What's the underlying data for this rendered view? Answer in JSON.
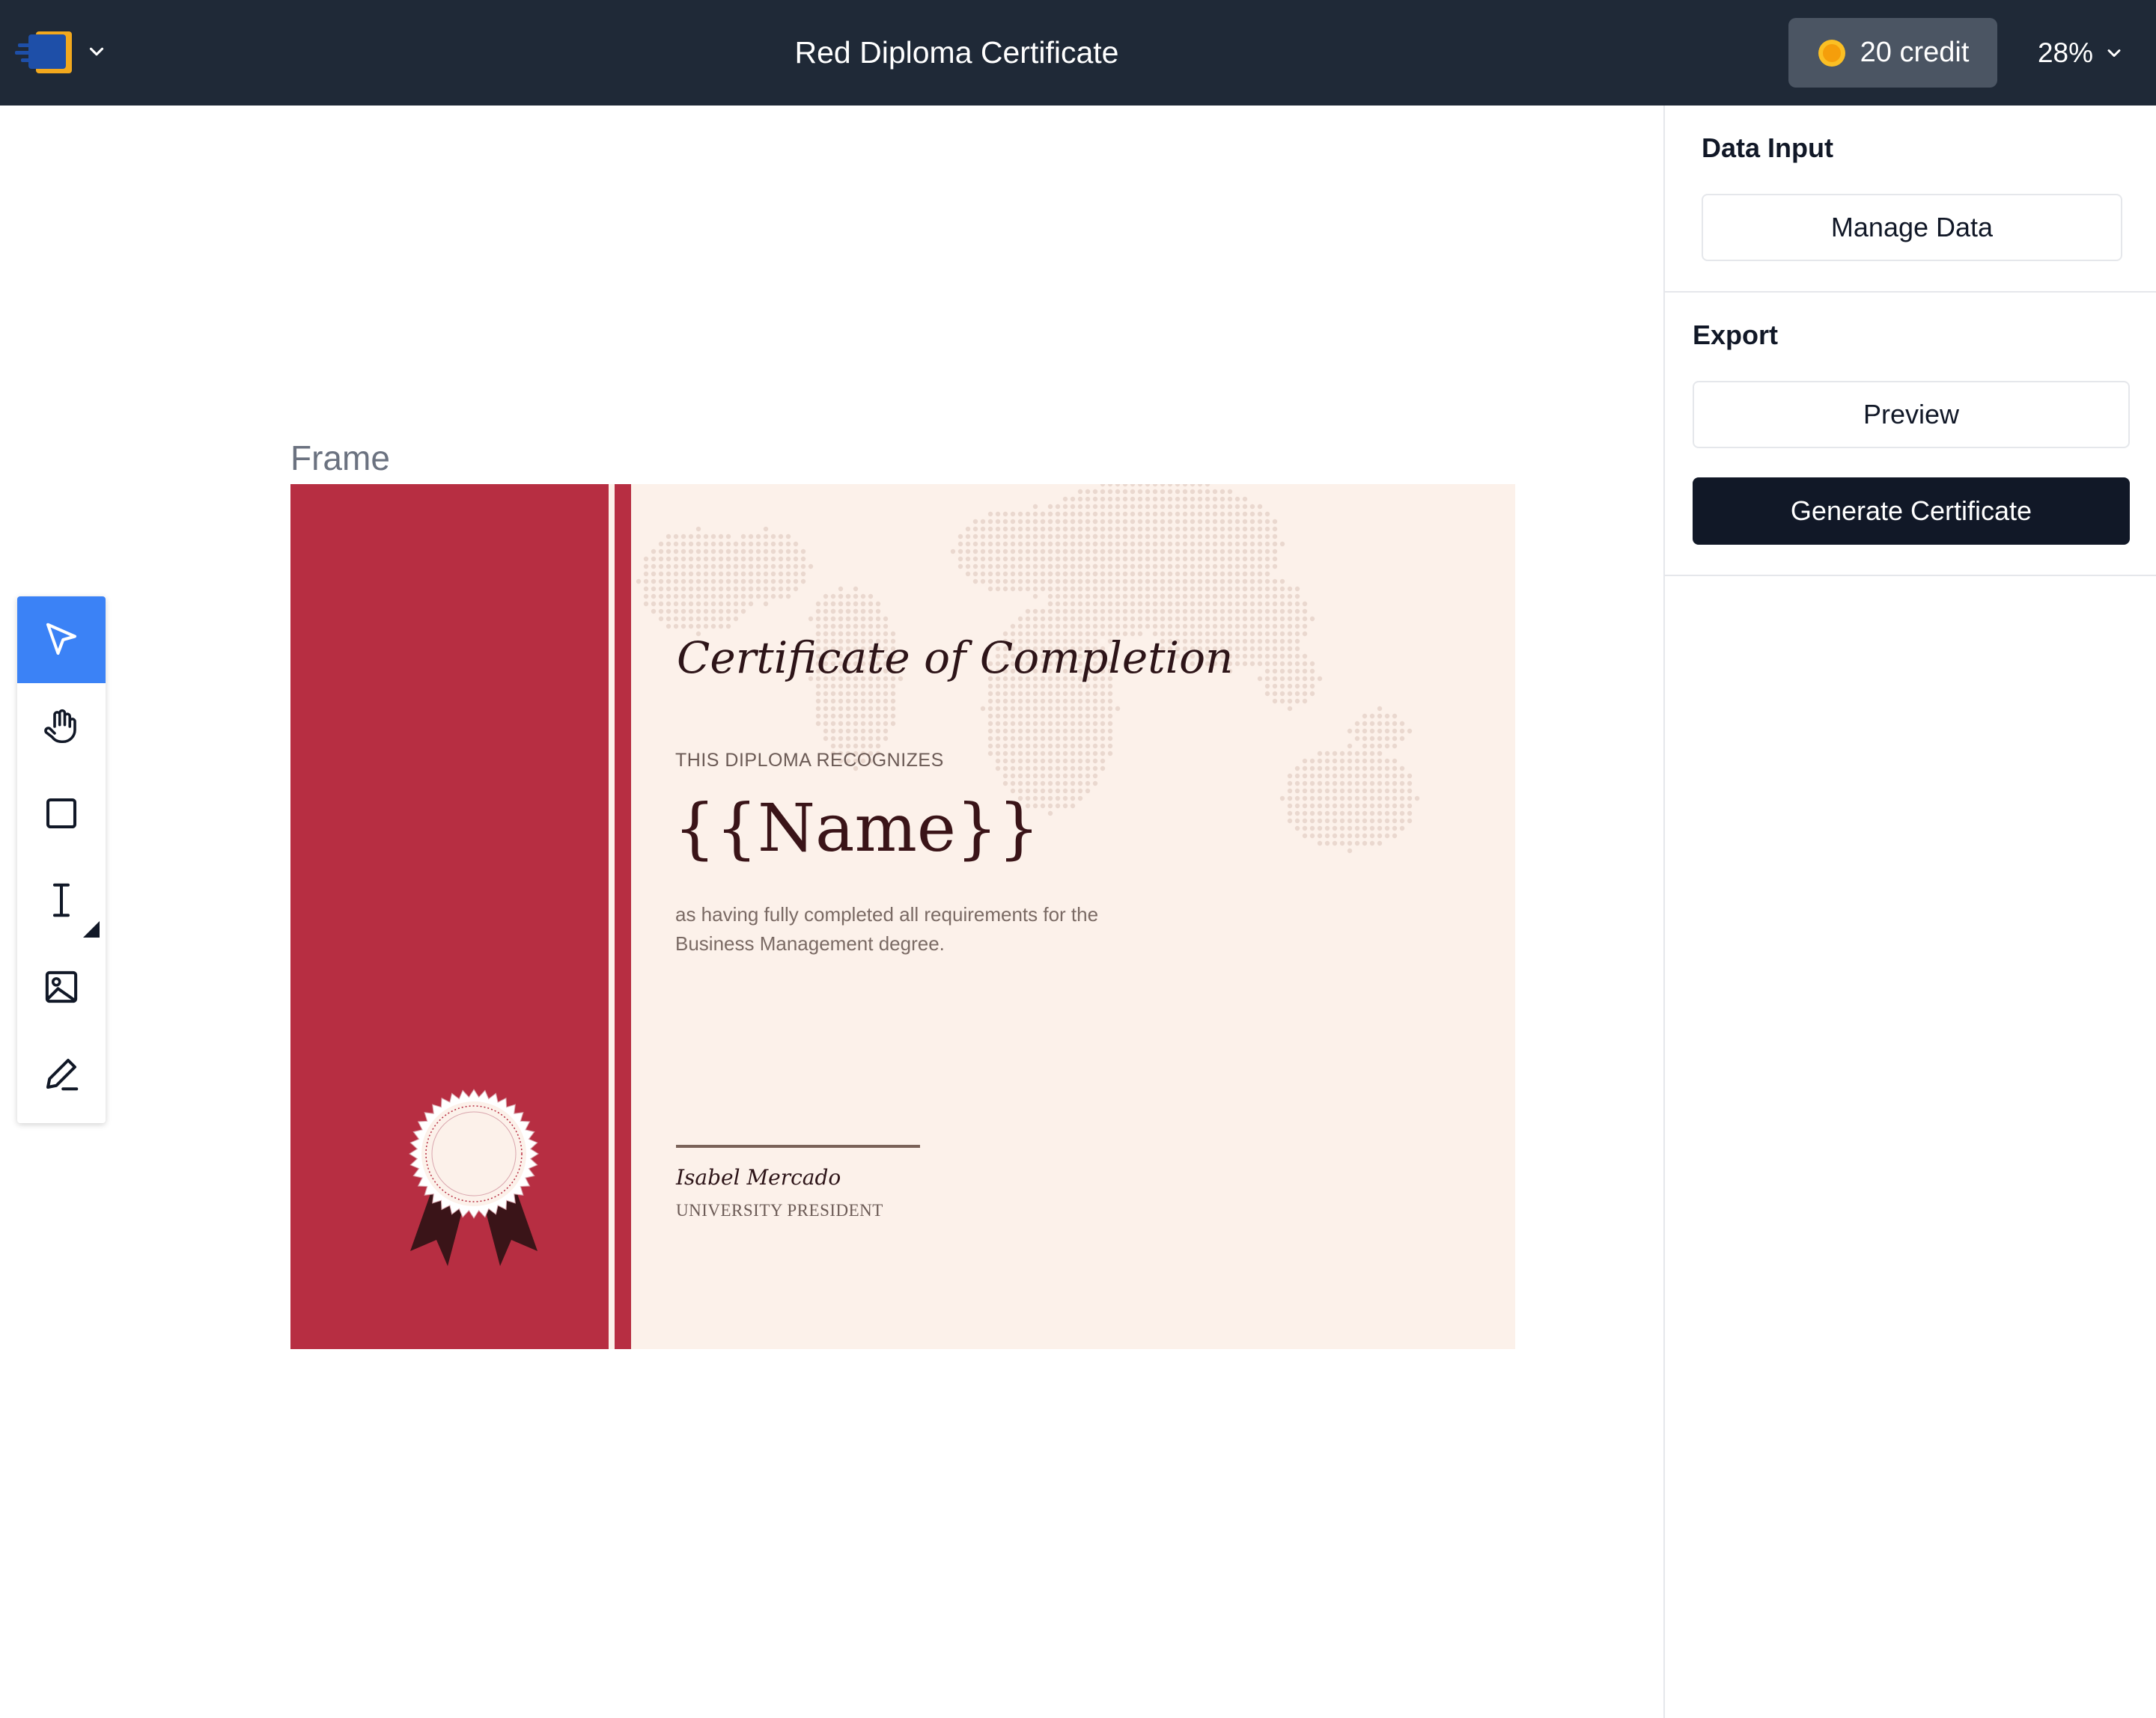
{
  "header": {
    "title": "Red Diploma Certificate",
    "credit_label": "20 credit",
    "zoom": "28%"
  },
  "canvas": {
    "frame_label": "Frame"
  },
  "certificate": {
    "title": "Certificate of Completion",
    "recognizes": "THIS DIPLOMA RECOGNIZES",
    "name_placeholder": "{{Name}}",
    "description": "as having fully completed all requirements for the Business Management degree.",
    "signer_name": "Isabel Mercado",
    "signer_role": "UNIVERSITY PRESIDENT",
    "colors": {
      "primary": "#b72e42",
      "background": "#fcf1ea",
      "ribbon": "#3a1418"
    }
  },
  "toolbar": {
    "tools": [
      "select-icon",
      "hand-icon",
      "rectangle-icon",
      "text-icon",
      "image-icon",
      "pen-icon"
    ],
    "active": "select-icon"
  },
  "panel": {
    "data_input_title": "Data Input",
    "manage_data_label": "Manage Data",
    "export_title": "Export",
    "preview_label": "Preview",
    "generate_label": "Generate Certificate"
  },
  "colors": {
    "topbar": "#1f2937",
    "accent": "#3b82f6",
    "coin": "#fbbf24"
  }
}
